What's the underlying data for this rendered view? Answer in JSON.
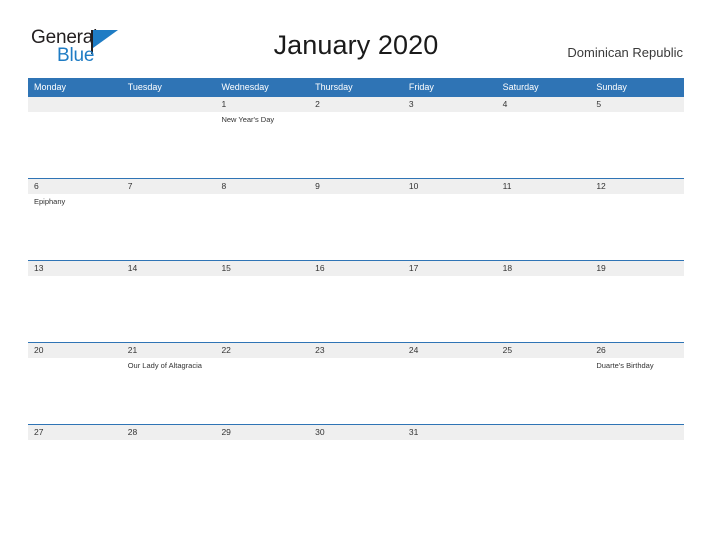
{
  "logo": {
    "word_top": "General",
    "word_bottom": "Blue",
    "flag_color": "#1f7cc4"
  },
  "header": {
    "title": "January 2020",
    "region": "Dominican Republic"
  },
  "theme": {
    "header_blue": "#2f74b5",
    "row_gray": "#efefef",
    "text_dark": "#333333"
  },
  "calendar": {
    "weekdays": [
      "Monday",
      "Tuesday",
      "Wednesday",
      "Thursday",
      "Friday",
      "Saturday",
      "Sunday"
    ],
    "weeks": [
      {
        "dates": [
          "",
          "",
          "1",
          "2",
          "3",
          "4",
          "5"
        ],
        "events": [
          "",
          "",
          "New Year's Day",
          "",
          "",
          "",
          ""
        ]
      },
      {
        "dates": [
          "6",
          "7",
          "8",
          "9",
          "10",
          "11",
          "12"
        ],
        "events": [
          "Epiphany",
          "",
          "",
          "",
          "",
          "",
          ""
        ]
      },
      {
        "dates": [
          "13",
          "14",
          "15",
          "16",
          "17",
          "18",
          "19"
        ],
        "events": [
          "",
          "",
          "",
          "",
          "",
          "",
          ""
        ]
      },
      {
        "dates": [
          "20",
          "21",
          "22",
          "23",
          "24",
          "25",
          "26"
        ],
        "events": [
          "",
          "Our Lady of Altagracia",
          "",
          "",
          "",
          "",
          "Duarte's Birthday"
        ]
      },
      {
        "dates": [
          "27",
          "28",
          "29",
          "30",
          "31",
          "",
          ""
        ],
        "events": [
          "",
          "",
          "",
          "",
          "",
          "",
          ""
        ]
      }
    ]
  }
}
